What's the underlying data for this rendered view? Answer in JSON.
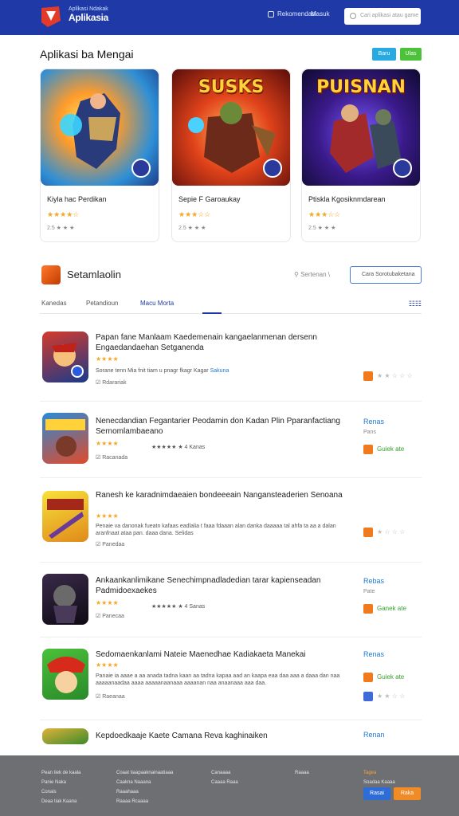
{
  "header": {
    "brand_top": "Aplikasi Ndakak",
    "brand_name": "Aplikasia",
    "nav_link_1": "Rekomendasi",
    "nav_link_2": "Masuk",
    "search_placeholder": "Cari aplikasi atau game"
  },
  "featured": {
    "title": "Aplikasi ba Mengai",
    "btn_blue": "Baru",
    "btn_green": "Ulas",
    "cards": [
      {
        "art_text": "",
        "title": "Kiyla hac Perdikan",
        "stars": "★★★★☆",
        "meta": "2.5 ★ ★ ★"
      },
      {
        "art_text": "SUSKS",
        "title": "Sepie F Garoaukay",
        "stars": "★★★☆☆",
        "meta": "2.5 ★ ★ ★"
      },
      {
        "art_text": "PUISNAN",
        "title": "Ptiskla Kgosiknmdarean",
        "stars": "★★★☆☆",
        "meta": "2.5 ★ ★ ★"
      }
    ]
  },
  "section": {
    "title": "Setamlaolin",
    "sort_label": "Sertenan \\",
    "sort_button": "Cara Sorotubaketana",
    "tabs": [
      "Kanedas",
      "Petandioun",
      "Macu Morta"
    ],
    "active_tab_index": 2
  },
  "list": [
    {
      "title": "Papan fane Manlaam Kaedemenain kangaelanmenan dersenn Engaedandaehan Setganenda",
      "stars": "★★★★",
      "desc": "Sorane tenn Mia fnit tiam u pnagr fkagr Kagar",
      "desc_link": "Sakuna",
      "foot": "Rdarariak",
      "side_title": "",
      "side_sub": "",
      "side_rating": "★ ★ ☆ ☆ ☆",
      "side_green": ""
    },
    {
      "title": "Nenecdandian Fegantarier Peodamin don Kadan Plin Pparanfactiang Sernomlambaeano",
      "stars": "★★★★",
      "desc": "★★★★★ ★ 4 Kanas",
      "desc_link": "",
      "foot": "Racanada",
      "side_title": "Renas",
      "side_sub": "Pans",
      "side_rating": "",
      "side_green": "Guiek ate"
    },
    {
      "title": "Ranesh ke karadnimdaeaien bondeeeain Nangansteaderien Senoana",
      "stars": "★★★★",
      "desc": "Penaie va danonak fueatn kafaas eadlalia t faaa fdaaan alan danka daaaaa tal ahfa ta aa a dalan aranfnaat ataa pan. daaa dana. Selidas",
      "desc_link": "",
      "foot": "Panedaa",
      "side_title": "",
      "side_sub": "",
      "side_rating": "★ ☆ ☆ ☆",
      "side_green": ""
    },
    {
      "title": "Ankaankanlimikane Senechimpnadladedian tarar kapienseadan Padmidoexaekes",
      "stars": "★★★★",
      "desc": "★★★★★ ★ 4 Sanas",
      "desc_link": "",
      "foot": "Panecaa",
      "side_title": "Rebas",
      "side_sub": "Pate",
      "side_rating": "",
      "side_green": "Ganek ate"
    },
    {
      "title": "Sedomaenkanlami Nateie Maenedhae Kadiakaeta Manekai",
      "stars": "★★★★",
      "desc": "Panaie ia aaae a aa anada tadna kaan aa tadna kapaa aad an kaapa eaa daa aaa a daaa dan naa aaaaanaadaa aaaa aaaaanaanaaa aaaanan naa anaanaaa aaa daa.",
      "desc_link": "",
      "foot": "Raeanaa",
      "side_title": "Renas",
      "side_sub": "",
      "side_rating": "★ ★ ☆ ☆",
      "side_green": "Guiek ate"
    },
    {
      "title": "Kepdoedkaaje Kaete Camana Reva kaghinaiken",
      "stars": "",
      "desc": "",
      "desc_link": "",
      "foot": "",
      "side_title": "Renan",
      "side_sub": "",
      "side_rating": "",
      "side_green": ""
    }
  ],
  "footer": {
    "col1": [
      "Pean tiek de kaala",
      "Panie Naka",
      "Conais",
      "Deaa tiak Kaana"
    ],
    "col2": [
      "Coaat tiaapaaknainaatiaaa",
      "Caakna Naaana",
      "Raaahaaa",
      "Raaaa Rcaaaa"
    ],
    "col3": [
      "Canaaaa",
      "Caaaa Raaa"
    ],
    "col4": [
      "Raaaa"
    ],
    "col5": [
      "Tagea",
      "Soadaa Kaaaa"
    ],
    "btn1": "Rasai",
    "btn2": "Raka"
  }
}
